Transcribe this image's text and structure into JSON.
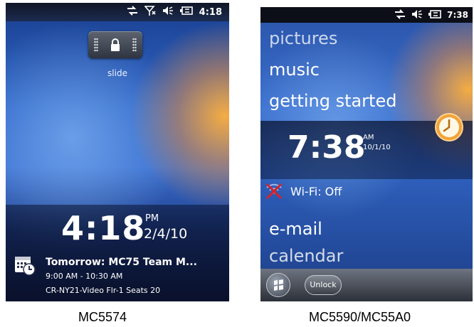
{
  "left_device": {
    "status_time": "4:18",
    "lock_hint": "slide",
    "time": "4:18",
    "ampm": "PM",
    "date": "2/4/10",
    "appointment": {
      "title": "Tomorrow: MC75 Team M...",
      "time": "9:00 AM - 10:30 AM",
      "location": "CR-NY21-Video Flr-1 Seats 20"
    },
    "caption": "MC5574"
  },
  "right_device": {
    "status_time": "7:38",
    "menu_top": [
      "pictures",
      "music",
      "getting started"
    ],
    "time": "7:38",
    "ampm": "AM",
    "date": "10/1/10",
    "wifi_status": "Wi-Fi: Off",
    "menu_bottom": [
      "e-mail",
      "calendar"
    ],
    "unlock_label": "Unlock",
    "caption": "MC5590/MC55A0"
  }
}
